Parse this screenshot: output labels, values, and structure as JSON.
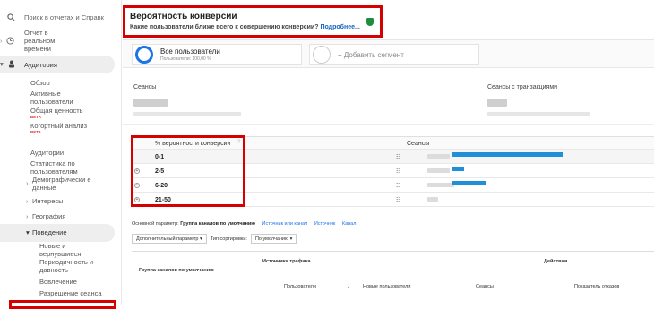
{
  "sidebar": {
    "search_placeholder": "Поиск в отчетах и Справк",
    "realtime": [
      "Отчет в",
      "реальном",
      "времени"
    ],
    "audience": "Аудитория",
    "items": [
      {
        "label": "Обзор"
      },
      {
        "label": "Активные пользователи"
      },
      {
        "label": "Общая ценность",
        "badge": "BETA"
      },
      {
        "label": "Когортный анализ",
        "badge": "BETA"
      },
      {
        "label": "Аудитории"
      },
      {
        "label": "Статистика по пользователям"
      },
      {
        "label": "Демографически е данные"
      },
      {
        "label": "Интересы"
      },
      {
        "label": "География"
      },
      {
        "label": "Поведение"
      }
    ],
    "behavior_items": [
      {
        "label": "Новые и вернувшиеся"
      },
      {
        "label": "Периодичность и давность"
      },
      {
        "label": "Вовлечение"
      },
      {
        "label": "Разрешение сеанса"
      }
    ]
  },
  "header": {
    "title": "Вероятность конверсии",
    "subtitle": "Какие пользователи ближе всего к совершению конверсии?",
    "link": "Подробнее..."
  },
  "segments": {
    "seg1_title": "Все пользователи",
    "seg1_sub": "Пользователи: 100,00 %",
    "seg2": "+ Добавить сегмент"
  },
  "metrics": {
    "sessions": "Сеансы",
    "sessions_tx": "Сеансы с транзакциями"
  },
  "table": {
    "col1": "% вероятности конверсии",
    "col2": "Сеансы",
    "rows": [
      {
        "label": "0-1",
        "bar": 0.62
      },
      {
        "label": "2-5",
        "bar": 0.18
      },
      {
        "label": "6-20",
        "bar": 0.22
      },
      {
        "label": "21-50",
        "bar": 0.08
      }
    ]
  },
  "params": {
    "label": "Основной параметр:",
    "active": "Группа каналов по умолчанию",
    "links": [
      "Источник или канал",
      "Источник",
      "Канал"
    ]
  },
  "controls": {
    "secondary": "Дополнительный параметр",
    "sort_label": "Тип сортировки:",
    "sort_value": "По умолчанию"
  },
  "grid": {
    "group": "Группа каналов по умолчанию",
    "traffic": "Источники трафика",
    "actions": "Действия",
    "users": "Пользователи",
    "new_users": "Новые пользователи",
    "sessions": "Сеансы",
    "bounce": "Показатель отказов"
  },
  "colors": {
    "accent": "#1a73e8",
    "highlight": "#d50000",
    "bar": "#1f8fd8",
    "shield": "#1e8e3e"
  }
}
